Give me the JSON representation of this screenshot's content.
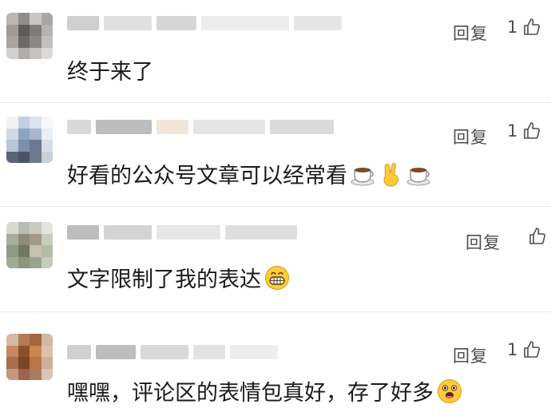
{
  "comments": [
    {
      "text": "终于来了",
      "reply_label": "回复",
      "like_count": "1",
      "emojis": []
    },
    {
      "text": "好看的公众号文章可以经常看",
      "reply_label": "回复",
      "like_count": "1",
      "emojis": [
        "coffee-emoji",
        "victory-hand-emoji",
        "coffee-emoji"
      ]
    },
    {
      "text": "文字限制了我的表达",
      "reply_label": "回复",
      "like_count": "",
      "emojis": [
        "grinning-face-emoji"
      ]
    },
    {
      "text": "嘿嘿，评论区的表情包真好，存了好多",
      "reply_label": "回复",
      "like_count": "1",
      "emojis": [
        "tongue-face-emoji"
      ]
    }
  ]
}
